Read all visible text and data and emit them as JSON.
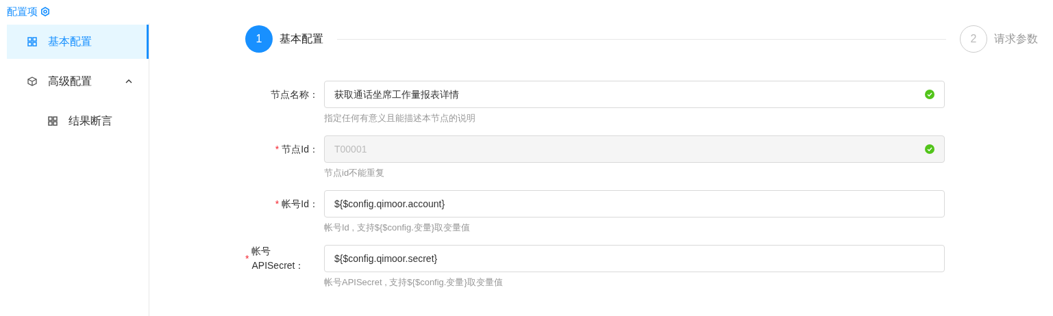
{
  "sidebar": {
    "title": "配置项",
    "items": [
      {
        "label": "基本配置",
        "kind": "grid",
        "selected": true
      },
      {
        "label": "高级配置",
        "kind": "cube",
        "selected": false,
        "expanded": true,
        "children": [
          {
            "label": "结果断言",
            "kind": "grid",
            "selected": false
          }
        ]
      }
    ]
  },
  "steps": [
    {
      "number": "1",
      "label": "基本配置",
      "selected": true
    },
    {
      "number": "2",
      "label": "请求参数",
      "selected": false
    }
  ],
  "form": {
    "required_mark": "*",
    "fields": [
      {
        "label": "节点名称：",
        "required": false,
        "value": "获取通话坐席工作量报表详情",
        "disabled": false,
        "valid": true,
        "help": "指定任何有意义且能描述本节点的说明"
      },
      {
        "label": "节点Id：",
        "required": true,
        "value": "T00001",
        "disabled": true,
        "valid": true,
        "help": "节点id不能重复"
      },
      {
        "label": "帐号Id：",
        "required": true,
        "value": "${$config.qimoor.account}",
        "disabled": false,
        "valid": false,
        "help": "帐号Id , 支持${$config.变量}取变量值"
      },
      {
        "label": "帐号APISecret：",
        "required": true,
        "value": "${$config.qimoor.secret}",
        "disabled": false,
        "valid": false,
        "help": "帐号APISecret , 支持${$config.变量}取变量值"
      }
    ]
  }
}
